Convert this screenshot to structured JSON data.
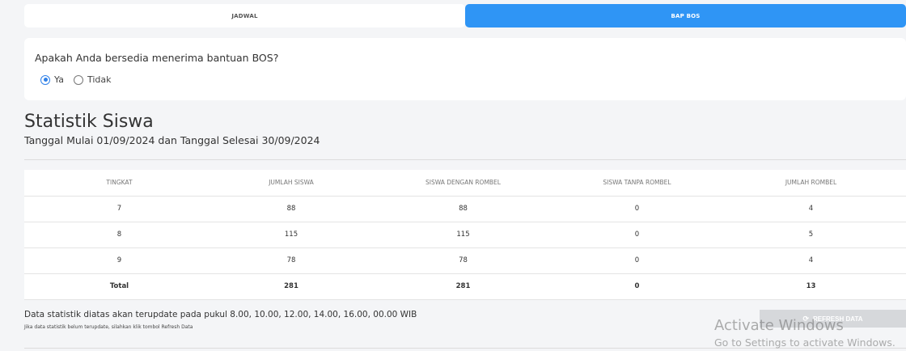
{
  "tabs": [
    {
      "label": "JADWAL",
      "active": false
    },
    {
      "label": "BAP BOS",
      "active": true
    }
  ],
  "bos_question": {
    "text": "Apakah Anda bersedia menerima bantuan BOS?",
    "options": [
      {
        "label": "Ya",
        "checked": true
      },
      {
        "label": "Tidak",
        "checked": false
      }
    ]
  },
  "statistics": {
    "title": "Statistik Siswa",
    "subtitle": "Tanggal Mulai 01/09/2024 dan Tanggal Selesai 30/09/2024",
    "columns": [
      "TINGKAT",
      "JUMLAH SISWA",
      "SISWA DENGAN ROMBEL",
      "SISWA TANPA ROMBEL",
      "JUMLAH ROMBEL"
    ],
    "rows": [
      [
        "7",
        "88",
        "88",
        "0",
        "4"
      ],
      [
        "8",
        "115",
        "115",
        "0",
        "5"
      ],
      [
        "9",
        "78",
        "78",
        "0",
        "4"
      ]
    ],
    "total": [
      "Total",
      "281",
      "281",
      "0",
      "13"
    ]
  },
  "footer": {
    "update_note": "Data statistik diatas akan terupdate pada pukul 8.00, 10.00, 12.00, 14.00, 16.00, 00.00 WIB",
    "help_note": "Jika data statistik belum terupdate, silahkan klik tombol Refresh Data",
    "refresh_label": "REFRESH DATA",
    "refresh_icon": "refresh-icon"
  },
  "watermark": {
    "title": "Activate Windows",
    "subtitle": "Go to Settings to activate Windows."
  },
  "colors": {
    "accent": "#2f95f5",
    "radio": "#2f80e8",
    "button_disabled": "#d6d8db"
  }
}
